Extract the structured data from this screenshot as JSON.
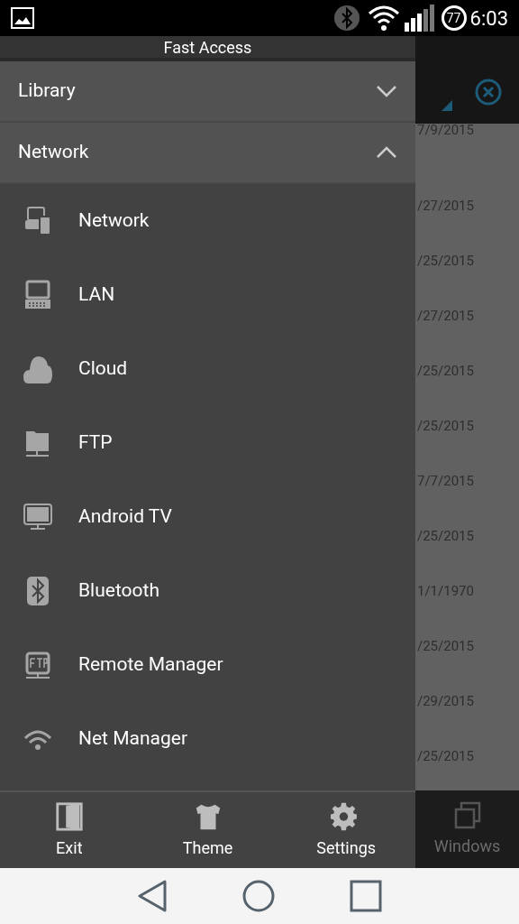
{
  "status_bar": {
    "battery": "77",
    "time": "6:03"
  },
  "drawer": {
    "title": "Fast Access",
    "sections": [
      {
        "label": "Library",
        "expanded": false
      },
      {
        "label": "Network",
        "expanded": true
      }
    ],
    "items": [
      {
        "kind": "devices",
        "label": "Network"
      },
      {
        "kind": "computer",
        "label": "LAN"
      },
      {
        "kind": "cloud",
        "label": "Cloud"
      },
      {
        "kind": "server",
        "label": "FTP"
      },
      {
        "kind": "monitor",
        "label": "Android TV"
      },
      {
        "kind": "bluetooth",
        "label": "Bluetooth"
      },
      {
        "kind": "ftp",
        "label": "Remote Manager"
      },
      {
        "kind": "wifi",
        "label": "Net Manager"
      }
    ],
    "actions": [
      {
        "kind": "exit",
        "label": "Exit"
      },
      {
        "kind": "theme",
        "label": "Theme"
      },
      {
        "kind": "settings",
        "label": "Settings"
      }
    ]
  },
  "background": {
    "dates": [
      "7/9/2015",
      "/27/2015",
      "/25/2015",
      "/27/2015",
      "/25/2015",
      "/25/2015",
      "7/7/2015",
      "/25/2015",
      "1/1/1970",
      "/25/2015",
      "/29/2015",
      "/25/2015"
    ],
    "windows_button": "Windows"
  }
}
